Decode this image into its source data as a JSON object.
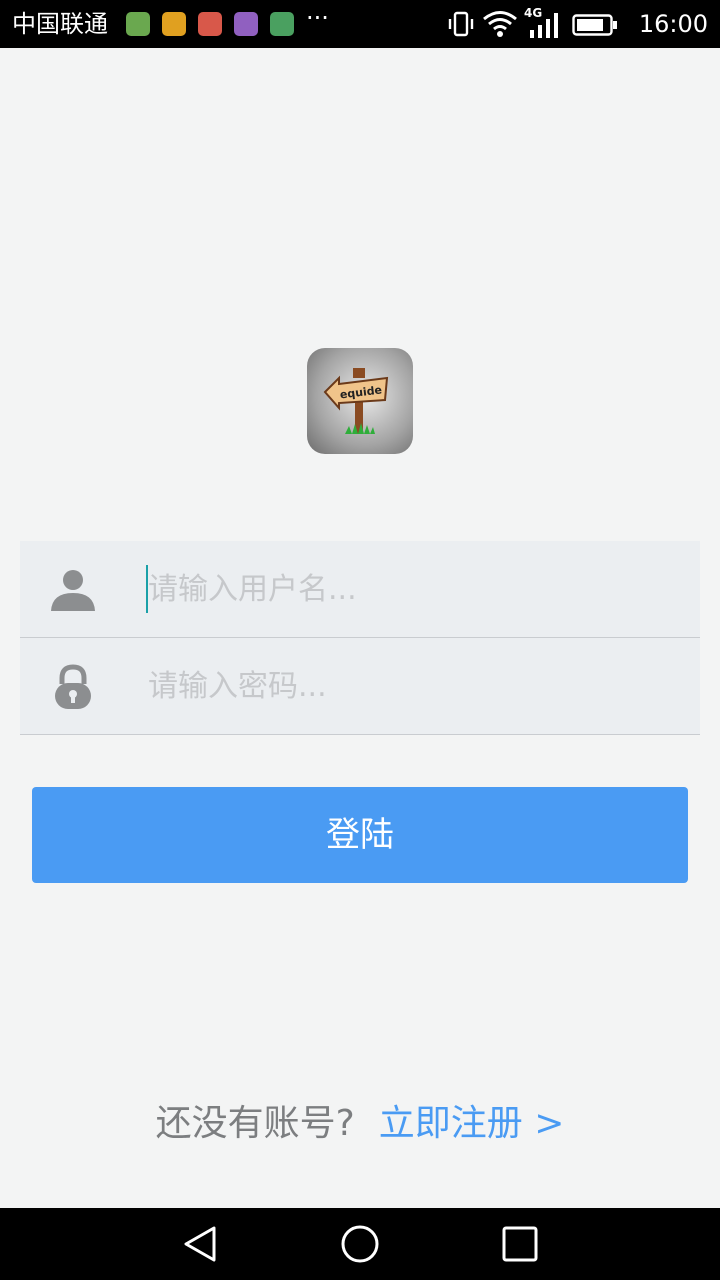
{
  "status_bar": {
    "carrier": "中国联通",
    "time": "16:00",
    "network": "4G",
    "notification_icons": [
      {
        "name": "app-icon-1",
        "color": "#6aa84f"
      },
      {
        "name": "app-icon-2",
        "color": "#e0a020"
      },
      {
        "name": "app-icon-3",
        "color": "#d8584a"
      },
      {
        "name": "app-icon-4",
        "color": "#9060c0"
      },
      {
        "name": "app-icon-5",
        "color": "#4aa060"
      }
    ],
    "more": "···"
  },
  "logo": {
    "text": "equide"
  },
  "login_form": {
    "username_placeholder": "请输入用户名...",
    "password_placeholder": "请输入密码..."
  },
  "login_button": "登陆",
  "register": {
    "question": "还没有账号?",
    "link": "立即注册 >"
  },
  "colors": {
    "accent": "#4a9bf3",
    "background": "#f3f4f4",
    "form_background": "#ebeef1",
    "icon": "#8c8e90"
  }
}
